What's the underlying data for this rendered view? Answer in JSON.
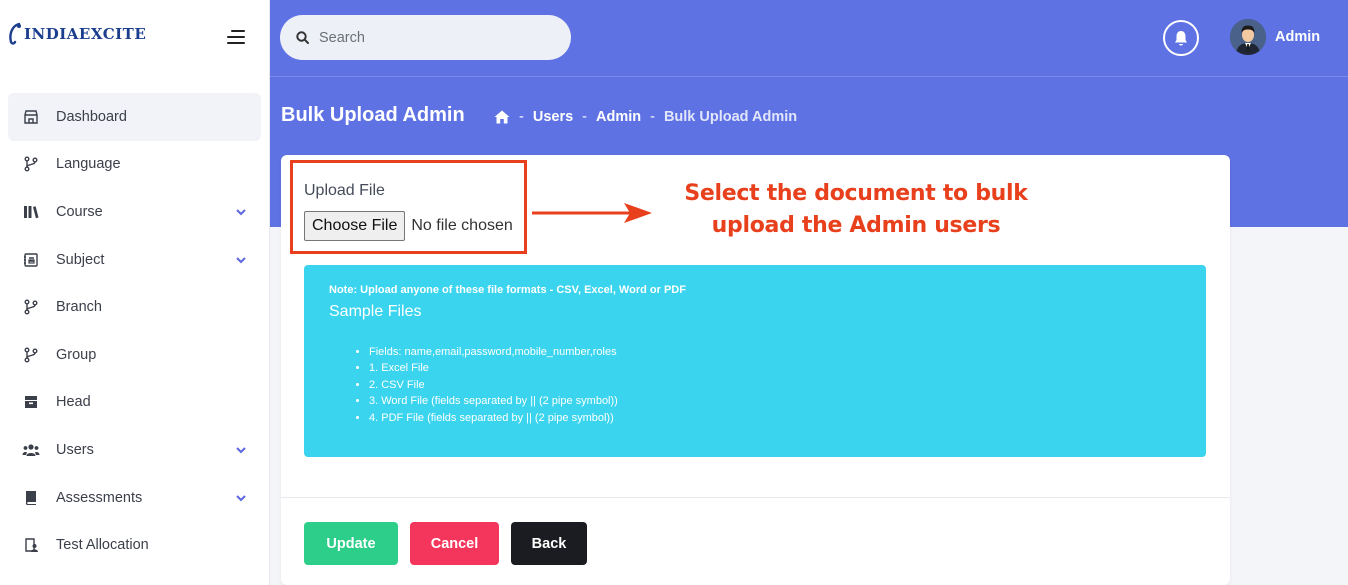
{
  "brand": {
    "name": "INDIAEXCITE"
  },
  "sidebar": {
    "items": [
      {
        "label": "Dashboard",
        "icon": "store-icon",
        "active": true,
        "expandable": false
      },
      {
        "label": "Language",
        "icon": "branch-icon",
        "active": false,
        "expandable": false
      },
      {
        "label": "Course",
        "icon": "books-icon",
        "active": false,
        "expandable": true
      },
      {
        "label": "Subject",
        "icon": "contact-card-icon",
        "active": false,
        "expandable": true
      },
      {
        "label": "Branch",
        "icon": "branch-icon",
        "active": false,
        "expandable": false
      },
      {
        "label": "Group",
        "icon": "branch-icon",
        "active": false,
        "expandable": false
      },
      {
        "label": "Head",
        "icon": "box-icon",
        "active": false,
        "expandable": false
      },
      {
        "label": "Users",
        "icon": "users-icon",
        "active": false,
        "expandable": true
      },
      {
        "label": "Assessments",
        "icon": "book-icon",
        "active": false,
        "expandable": true
      },
      {
        "label": "Test Allocation",
        "icon": "clipboard-user-icon",
        "active": false,
        "expandable": false
      }
    ]
  },
  "header": {
    "search_placeholder": "Search",
    "user_name": "Admin"
  },
  "page": {
    "title": "Bulk Upload Admin",
    "breadcrumb": {
      "home_icon": "home-icon",
      "items": [
        "Users",
        "Admin",
        "Bulk Upload Admin"
      ],
      "separator": "-"
    }
  },
  "form": {
    "upload_label": "Upload File",
    "choose_button": "Choose File",
    "file_status": "No file chosen"
  },
  "annotation": {
    "line1": "Select the document to bulk",
    "line2": "upload the Admin users"
  },
  "note": {
    "title": "Note: Upload anyone of these file formats - CSV, Excel, Word or PDF",
    "sample_title": "Sample Files",
    "items": [
      "Fields: name,email,password,mobile_number,roles",
      "1. Excel File",
      "2. CSV File",
      "3. Word File (fields separated by || (2 pipe symbol))",
      "4. PDF File (fields separated by || (2 pipe symbol))"
    ]
  },
  "actions": {
    "update": "Update",
    "cancel": "Cancel",
    "back": "Back"
  },
  "colors": {
    "primary": "#5e72e4",
    "success": "#2dce89",
    "danger": "#f5365c",
    "dark": "#1b1c22",
    "info": "#3ad4ee",
    "annotation": "#e8401c",
    "brand": "#1c3e8e"
  }
}
